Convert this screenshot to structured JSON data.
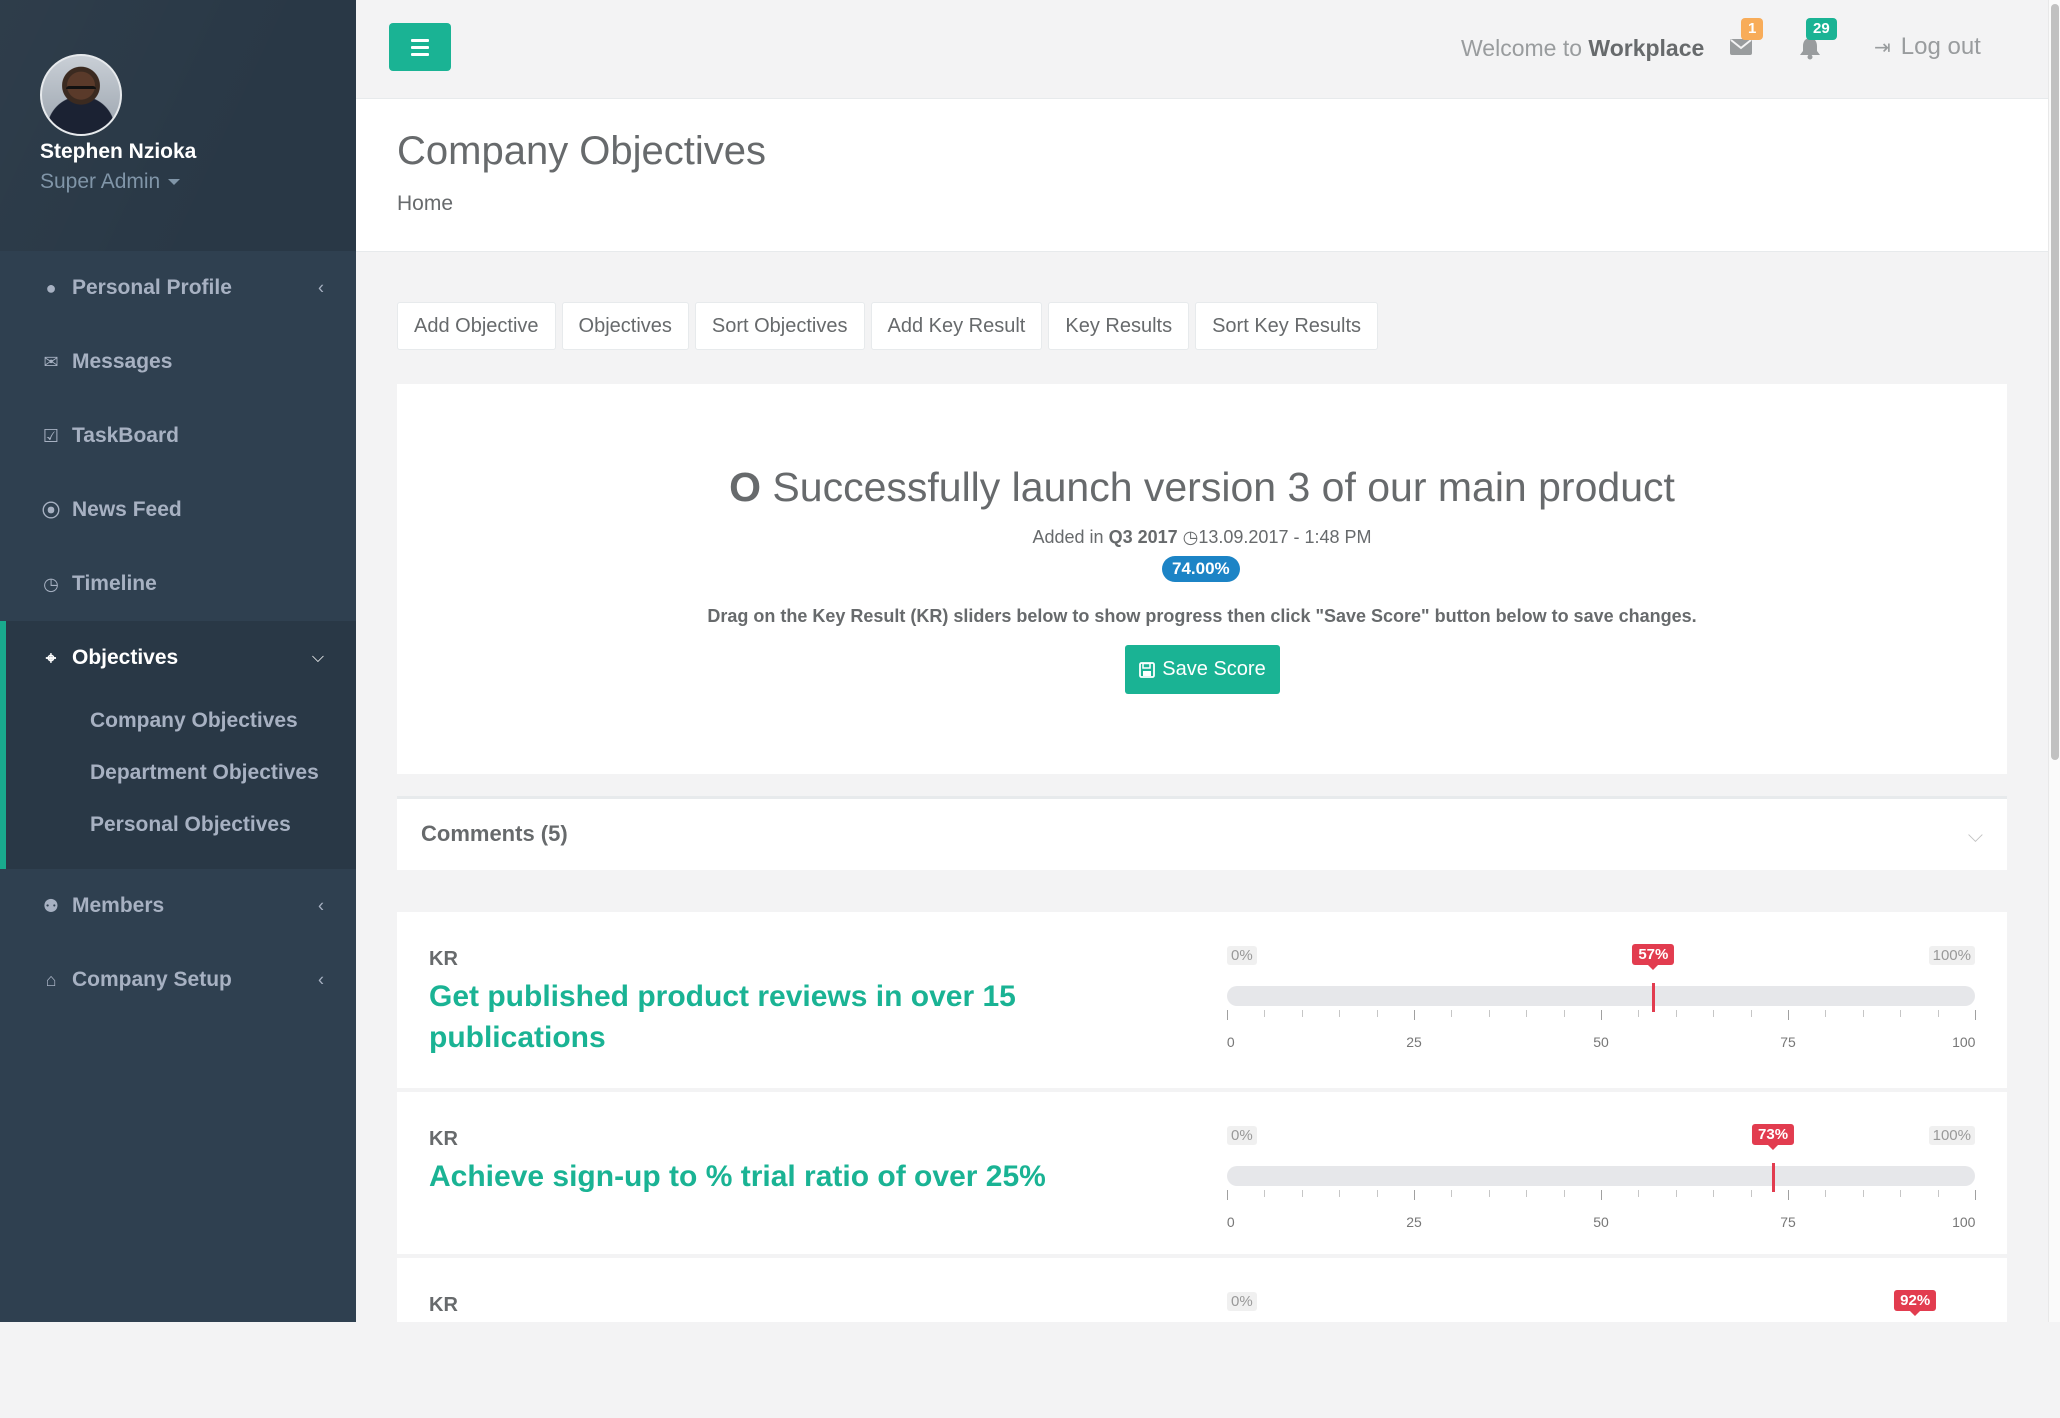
{
  "user": {
    "name": "Stephen Nzioka",
    "role": "Super Admin"
  },
  "sidebar": {
    "items": [
      {
        "label": "Personal Profile",
        "icon": "user-icon",
        "glyph": "●"
      },
      {
        "label": "Messages",
        "icon": "envelope-icon",
        "glyph": "✉"
      },
      {
        "label": "TaskBoard",
        "icon": "check-square-icon",
        "glyph": "☑"
      },
      {
        "label": "News Feed",
        "icon": "rss-icon",
        "glyph": "⦿"
      },
      {
        "label": "Timeline",
        "icon": "clock-icon",
        "glyph": "◷"
      }
    ],
    "active": {
      "label": "Objectives",
      "icon": "crosshair-icon",
      "glyph": "⌖",
      "sub": [
        "Company Objectives",
        "Department Objectives",
        "Personal Objectives"
      ]
    },
    "items_after": [
      {
        "label": "Members",
        "icon": "users-icon",
        "glyph": "⚉"
      },
      {
        "label": "Company Setup",
        "icon": "bank-icon",
        "glyph": "⌂"
      }
    ]
  },
  "topbar": {
    "welcome_prefix": "Welcome to",
    "welcome_brand": "Workplace",
    "mail_count": "1",
    "notif_count": "29",
    "logout_label": "Log out"
  },
  "page": {
    "title": "Company Objectives",
    "breadcrumb": "Home"
  },
  "actions": [
    "Add Objective",
    "Objectives",
    "Sort Objectives",
    "Add Key Result",
    "Key Results",
    "Sort Key Results"
  ],
  "objective": {
    "prefix": "O",
    "title": "Successfully launch version 3 of our main product",
    "added_label": "Added in",
    "quarter": "Q3 2017",
    "datetime": "13.09.2017 - 1:48 PM",
    "score": "74.00%",
    "instructions": "Drag on the Key Result (KR) sliders below to show progress then click \"Save Score\" button below to save changes.",
    "save_label": "Save Score"
  },
  "comments": {
    "label": "Comments (5)"
  },
  "slider_labels": {
    "min": "0%",
    "max": "100%",
    "ticks": [
      "0",
      "25",
      "50",
      "75",
      "100"
    ]
  },
  "key_results": [
    {
      "tag": "KR",
      "title": "Get published product reviews in over 15 publications",
      "value": 57,
      "value_label": "57%"
    },
    {
      "tag": "KR",
      "title": "Achieve sign-up to % trial ratio of over 25%",
      "value": 73,
      "value_label": "73%"
    },
    {
      "tag": "KR",
      "title": "",
      "value": 92,
      "value_label": "92%"
    }
  ],
  "colors": {
    "accent": "#1ab394",
    "sidebar": "#2f4050",
    "badge_orange": "#f8ac59",
    "slider_red": "#e23c4f",
    "pill_blue": "#1c84c6"
  }
}
